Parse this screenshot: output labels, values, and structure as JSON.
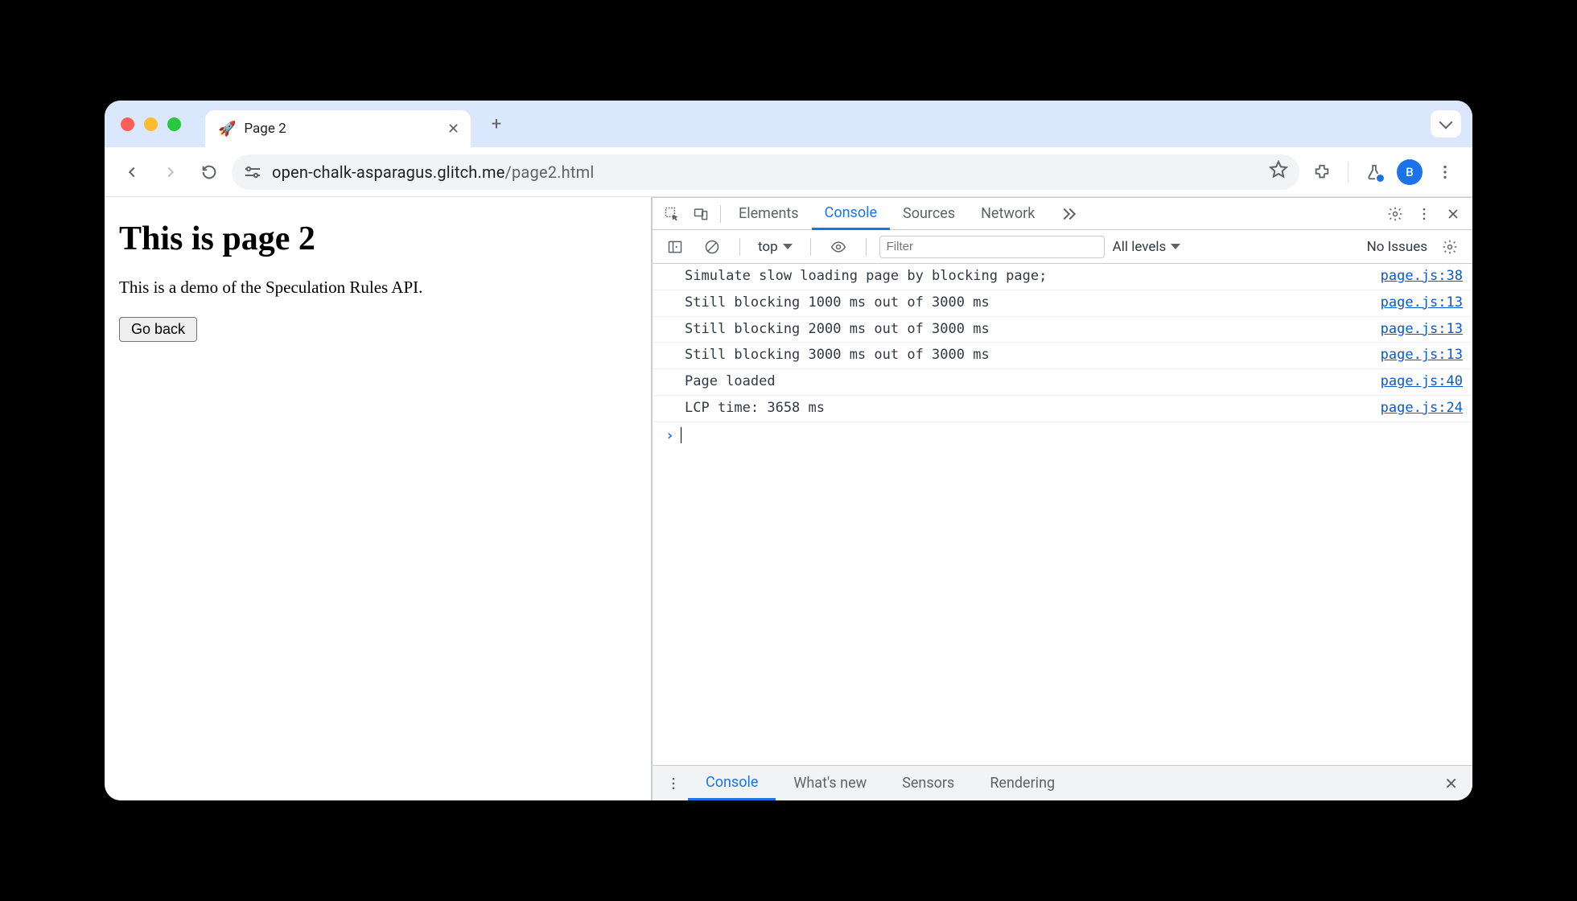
{
  "tab": {
    "favicon": "🚀",
    "title": "Page 2"
  },
  "toolbar": {
    "url_host": "open-chalk-asparagus.glitch.me",
    "url_path": "/page2.html",
    "avatar_initial": "B"
  },
  "page": {
    "heading": "This is page 2",
    "paragraph": "This is a demo of the Speculation Rules API.",
    "button": "Go back"
  },
  "devtools": {
    "tabs": [
      "Elements",
      "Console",
      "Sources",
      "Network"
    ],
    "active_tab": "Console",
    "console_toolbar": {
      "context": "top",
      "filter_placeholder": "Filter",
      "levels": "All levels",
      "issues": "No Issues"
    },
    "messages": [
      {
        "text": "Simulate slow loading page by blocking page;",
        "src": "page.js:38"
      },
      {
        "text": "Still blocking 1000 ms out of 3000 ms",
        "src": "page.js:13"
      },
      {
        "text": "Still blocking 2000 ms out of 3000 ms",
        "src": "page.js:13"
      },
      {
        "text": "Still blocking 3000 ms out of 3000 ms",
        "src": "page.js:13"
      },
      {
        "text": "Page loaded",
        "src": "page.js:40"
      },
      {
        "text": "LCP time: 3658 ms",
        "src": "page.js:24"
      }
    ],
    "drawer_tabs": [
      "Console",
      "What's new",
      "Sensors",
      "Rendering"
    ],
    "drawer_active": "Console"
  }
}
